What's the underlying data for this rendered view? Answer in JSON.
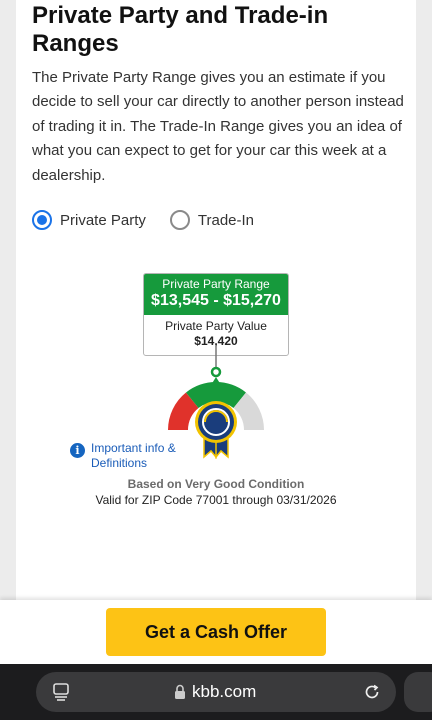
{
  "section": {
    "title": "Private Party and Trade-in Ranges",
    "description": "The Private Party Range gives you an estimate if you decide to sell your car directly to another person instead of trading it in. The Trade-In Range gives you an idea of what you can expect to get for your car this week at a dealership."
  },
  "radios": {
    "private_party": {
      "label": "Private Party",
      "checked": true
    },
    "trade_in": {
      "label": "Trade-In",
      "checked": false
    }
  },
  "range": {
    "label": "Private Party Range",
    "value": "$13,545 - $15,270",
    "ppv_label": "Private Party Value",
    "ppv_value": "$14,420"
  },
  "gauge": {
    "colors": {
      "low": "#e0322b",
      "mid": "#169a3c",
      "high": "#d9d9d9"
    },
    "badge_color": "#1a3d7c",
    "ribbon_color": "#1a3d7c"
  },
  "info": {
    "icon": "info-icon",
    "label": "Important info & Definitions"
  },
  "condition": "Based on Very Good Condition",
  "validity": "Valid for ZIP Code 77001 through 03/31/2026",
  "cta": {
    "label": "Get a Cash Offer",
    "color": "#fdc315"
  },
  "browser": {
    "url": "kbb.com",
    "icons": [
      "tabs-icon",
      "lock-icon",
      "reload-icon"
    ]
  }
}
